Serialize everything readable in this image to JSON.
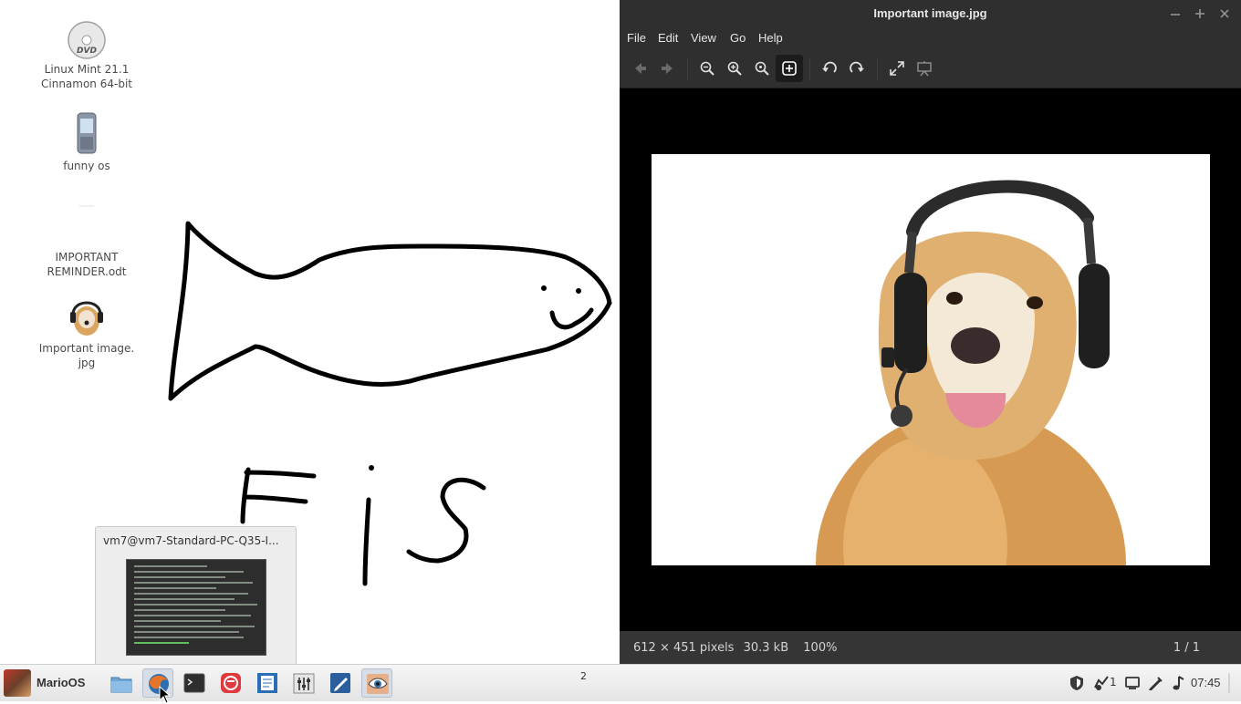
{
  "desktop": {
    "icons": [
      {
        "label_line1": "Linux Mint 21.1",
        "label_line2": "Cinnamon 64-bit",
        "icon": "dvd-icon"
      },
      {
        "label_line1": "funny os",
        "label_line2": "",
        "icon": "phone-icon"
      },
      {
        "label_line1": "IMPORTANT",
        "label_line2": "REMINDER.odt",
        "icon": "document-icon"
      },
      {
        "label_line1": "Important image.",
        "label_line2": "jpg",
        "icon": "image-thumbnail-icon"
      }
    ]
  },
  "viewer": {
    "title": "Important image.jpg",
    "menu": [
      "File",
      "Edit",
      "View",
      "Go",
      "Help"
    ],
    "toolbar_icons": [
      "back-arrow-icon",
      "forward-arrow-icon",
      "zoom-out-icon",
      "zoom-in-icon",
      "zoom-normal-icon",
      "best-fit-icon",
      "rotate-left-icon",
      "rotate-right-icon",
      "fullscreen-icon",
      "slideshow-icon"
    ],
    "status": {
      "dimensions": "612 × 451 pixels",
      "size": "30.3 kB",
      "zoom": "100%",
      "position": "1 / 1"
    }
  },
  "preview": {
    "title": "vm7@vm7-Standard-PC-Q35-I..."
  },
  "taskbar": {
    "menu_label": "MarioOS",
    "workspace_count": "2",
    "tray": {
      "network_count": "1"
    },
    "clock": "07:45"
  }
}
